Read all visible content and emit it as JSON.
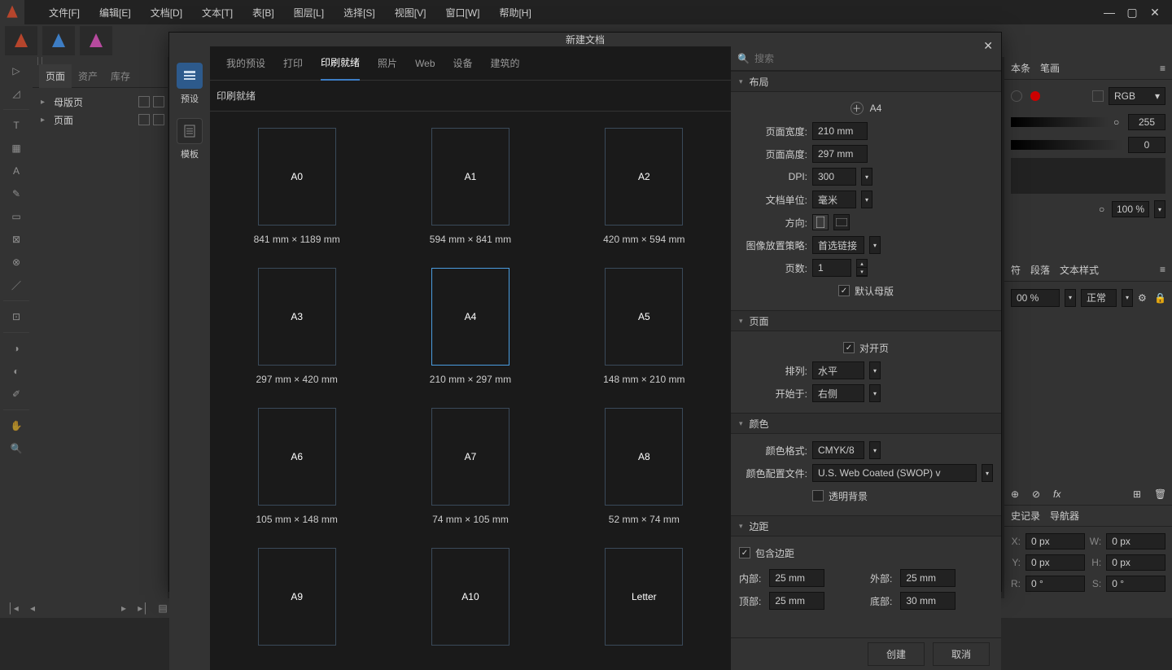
{
  "titlebar": {
    "menu": [
      "文件[F]",
      "编辑[E]",
      "文档[D]",
      "文本[T]",
      "表[B]",
      "图层[L]",
      "选择[S]",
      "视图[V]",
      "窗口[W]",
      "帮助[H]"
    ]
  },
  "left_panel": {
    "tabs": [
      "页面",
      "资产",
      "库存"
    ],
    "tree": [
      {
        "label": "母版页"
      },
      {
        "label": "页面"
      }
    ]
  },
  "modal": {
    "title": "新建文档",
    "left": [
      {
        "label": "预设",
        "active": true
      },
      {
        "label": "模板",
        "active": false
      }
    ],
    "tabs": [
      "我的预设",
      "打印",
      "印刷就绪",
      "照片",
      "Web",
      "设备",
      "建筑的"
    ],
    "active_tab": "印刷就绪",
    "section_label": "印刷就绪",
    "presets": [
      {
        "name": "A0",
        "dim": "841 mm × 1189 mm"
      },
      {
        "name": "A1",
        "dim": "594 mm × 841 mm"
      },
      {
        "name": "A2",
        "dim": "420 mm × 594 mm"
      },
      {
        "name": "A3",
        "dim": "297 mm × 420 mm"
      },
      {
        "name": "A4",
        "dim": "210 mm × 297 mm",
        "selected": true
      },
      {
        "name": "A5",
        "dim": "148 mm × 210 mm"
      },
      {
        "name": "A6",
        "dim": "105 mm × 148 mm"
      },
      {
        "name": "A7",
        "dim": "74 mm × 105 mm"
      },
      {
        "name": "A8",
        "dim": "52 mm × 74 mm"
      },
      {
        "name": "A9",
        "dim": ""
      },
      {
        "name": "A10",
        "dim": ""
      },
      {
        "name": "Letter",
        "dim": ""
      }
    ],
    "search_placeholder": "搜索",
    "sections": {
      "layout": {
        "title": "布局",
        "preset_name": "A4",
        "width_label": "页面宽度:",
        "width": "210 mm",
        "height_label": "页面高度:",
        "height": "297 mm",
        "dpi_label": "DPI:",
        "dpi": "300",
        "units_label": "文档单位:",
        "units": "毫米",
        "orient_label": "方向:",
        "placement_label": "图像放置策略:",
        "placement": "首选链接",
        "pages_label": "页数:",
        "pages": "1",
        "default_master": "默认母版"
      },
      "pages": {
        "title": "页面",
        "facing": "对开页",
        "arrange_label": "排列:",
        "arrange": "水平",
        "start_label": "开始于:",
        "start": "右侧"
      },
      "color": {
        "title": "颜色",
        "format_label": "颜色格式:",
        "format": "CMYK/8",
        "profile_label": "颜色配置文件:",
        "profile": "U.S. Web Coated (SWOP) v",
        "transparent": "透明背景"
      },
      "margins": {
        "title": "边距",
        "include": "包含边距",
        "inner_label": "内部:",
        "inner": "25 mm",
        "outer_label": "外部:",
        "outer": "25 mm",
        "top_label": "顶部:",
        "top": "25 mm",
        "bottom_label": "底部:",
        "bottom": "30 mm"
      }
    },
    "buttons": {
      "create": "创建",
      "cancel": "取消"
    }
  },
  "right": {
    "color_tabs": [
      "本条",
      "笔画"
    ],
    "rgb": "RGB",
    "alpha": "255",
    "zero": "0",
    "opacity": "100 %",
    "para_tabs": [
      "符",
      "段落",
      "文本样式"
    ],
    "para_val": "00 %",
    "para_mode": "正常",
    "layer_tabs": [
      "史记录",
      "导航器"
    ],
    "transform": {
      "x": "X:",
      "xv": "0 px",
      "w": "W:",
      "wv": "0 px",
      "y": "Y:",
      "yv": "0 px",
      "h": "H:",
      "hv": "0 px",
      "r": "R:",
      "rv": "0 °",
      "s": "S:",
      "sv": "0 °"
    }
  }
}
